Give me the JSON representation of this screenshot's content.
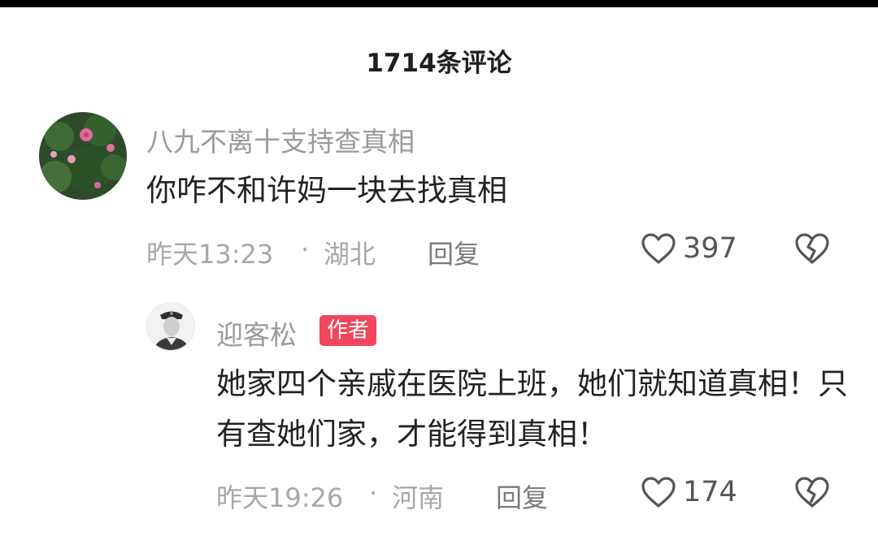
{
  "header": {
    "title": "1714条评论"
  },
  "comments": [
    {
      "username": "八九不离十支持查真相",
      "text": "你咋不和许妈一块去找真相",
      "time": "昨天13:23",
      "separator": "·",
      "location": "湖北",
      "reply_label": "回复",
      "likes": "397",
      "avatar_icon": "flower-avatar",
      "like_icon": "heart-outline-icon",
      "dislike_icon": "broken-heart-icon"
    },
    {
      "username": "迎客松",
      "badge": "作者",
      "text": "她家四个亲戚在医院上班，她们就知道真相！只有查她们家，才能得到真相！",
      "time": "昨天19:26",
      "separator": "·",
      "location": "河南",
      "reply_label": "回复",
      "likes": "174",
      "avatar_icon": "soldier-portrait-avatar",
      "like_icon": "heart-outline-icon",
      "dislike_icon": "broken-heart-icon"
    }
  ],
  "colors": {
    "badge": "#f0475c",
    "meta_text": "#a7a7a7",
    "username": "#9a9a9a",
    "content": "#222222"
  }
}
